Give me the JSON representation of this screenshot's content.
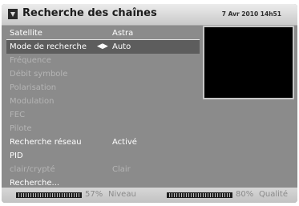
{
  "header": {
    "title": "Recherche des chaînes",
    "datetime": "7 Avr 2010 14h51",
    "icon": "satellite-search-icon"
  },
  "menu": {
    "rows": [
      {
        "label": "Satellite",
        "value": "Astra",
        "state": "active"
      },
      {
        "label": "Mode de recherche",
        "value": "Auto",
        "state": "selected",
        "arrows": "◀▶"
      },
      {
        "label": "Fréquence",
        "value": "",
        "state": "disabled"
      },
      {
        "label": "Débit symbole",
        "value": "",
        "state": "disabled"
      },
      {
        "label": "Polarisation",
        "value": "",
        "state": "disabled"
      },
      {
        "label": "Modulation",
        "value": "",
        "state": "disabled"
      },
      {
        "label": "FEC",
        "value": "",
        "state": "disabled"
      },
      {
        "label": "Pilote",
        "value": "",
        "state": "disabled"
      },
      {
        "label": "Recherche réseau",
        "value": "Activé",
        "state": "active"
      },
      {
        "label": "PID",
        "value": "",
        "state": "active"
      },
      {
        "label": "clair/crypté",
        "value": "Clair",
        "state": "disabled"
      },
      {
        "label": "Recherche...",
        "value": "",
        "state": "active"
      }
    ]
  },
  "footer": {
    "level": {
      "percent": "57%",
      "fraction": 0.57,
      "label": "Niveau"
    },
    "quality": {
      "percent": "80%",
      "fraction": 0.8,
      "label": "Qualité"
    }
  },
  "colors": {
    "panel": "#8b8b8b",
    "selection": "#5d5d5d",
    "preview": "#000000"
  }
}
